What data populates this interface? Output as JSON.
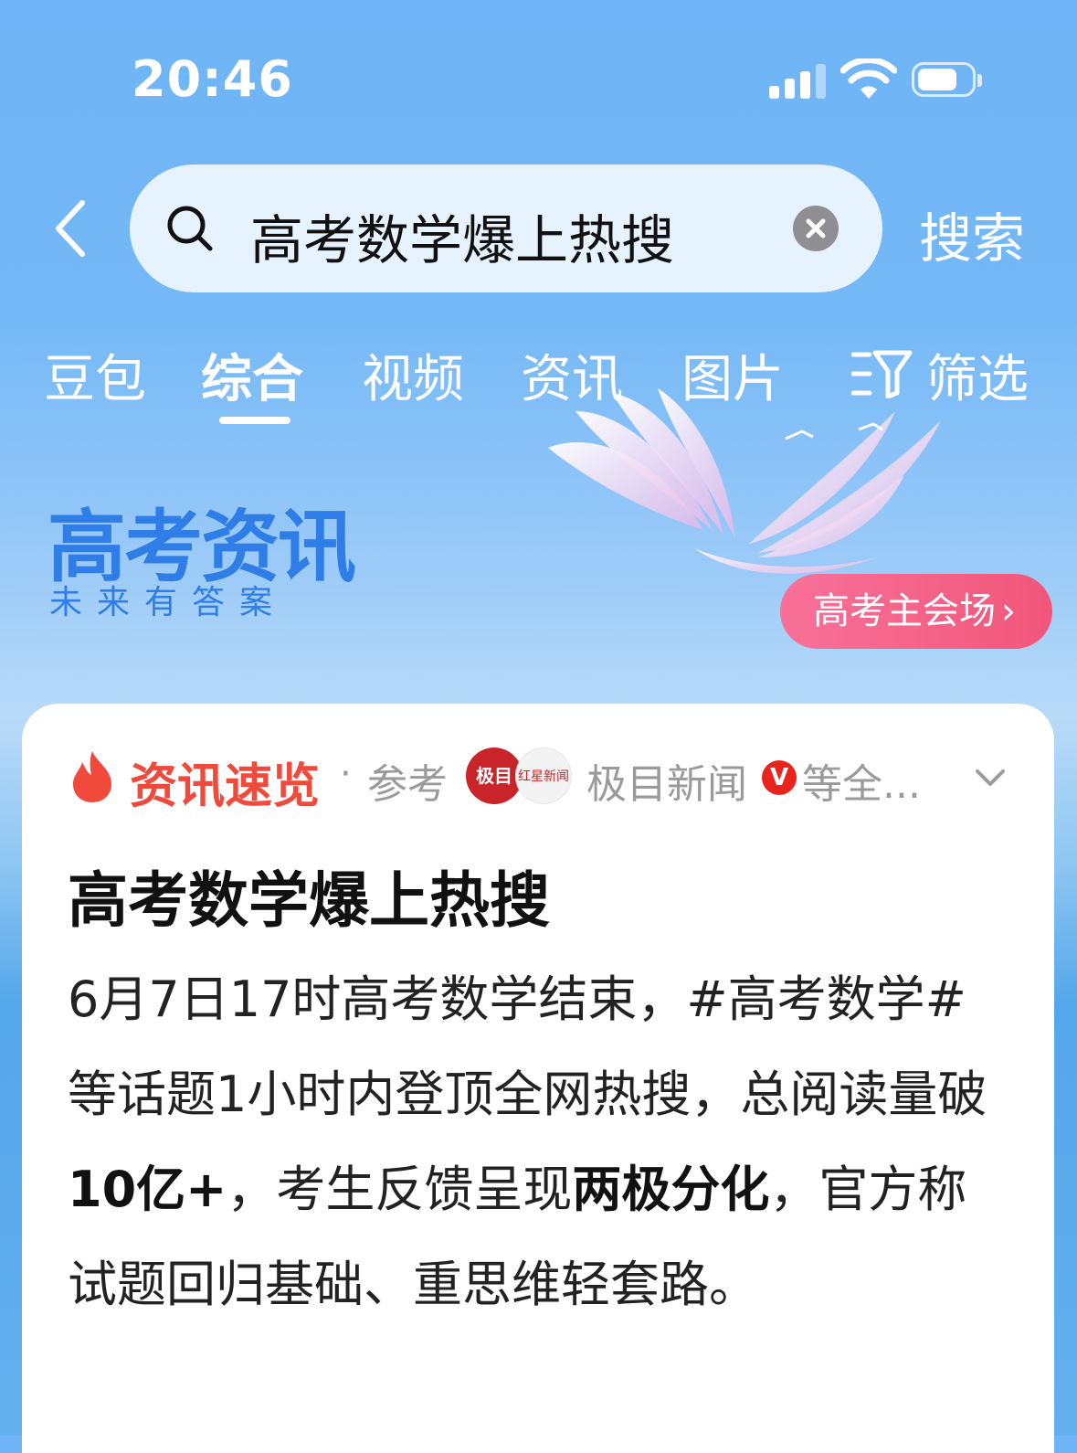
{
  "status_bar": {
    "time": "20:46"
  },
  "search": {
    "query": "高考数学爆上热搜",
    "submit_label": "搜索"
  },
  "tabs": [
    {
      "label": "豆包",
      "active": false
    },
    {
      "label": "综合",
      "active": true
    },
    {
      "label": "视频",
      "active": false
    },
    {
      "label": "资讯",
      "active": false
    },
    {
      "label": "图片",
      "active": false
    },
    {
      "label": "筛选",
      "active": false
    }
  ],
  "banner": {
    "title": "高考资讯",
    "subtitle": "未来有答案",
    "button_label": "高考主会场"
  },
  "card": {
    "section_label": "资讯速览",
    "separator": "·",
    "ref_label": "参考",
    "source_logo_1": "极目",
    "source_logo_2": "红星新闻",
    "source_name": "极目新闻",
    "verified_mark": "V",
    "source_more": "等全...",
    "title": "高考数学爆上热搜",
    "body": {
      "part1": "6月7日17时高考数学结束，#高考数学#等话题1小时内登顶全网热搜，总阅读量破",
      "bold1": "10亿+",
      "part2": "，考生反馈呈现",
      "bold2": "两极分化",
      "part3": "，官方称试题回归基础、重思维轻套路。"
    }
  },
  "colors": {
    "accent_red": "#f04a3c",
    "banner_blue": "#2f7de6",
    "button_pink": "#f2567a"
  }
}
